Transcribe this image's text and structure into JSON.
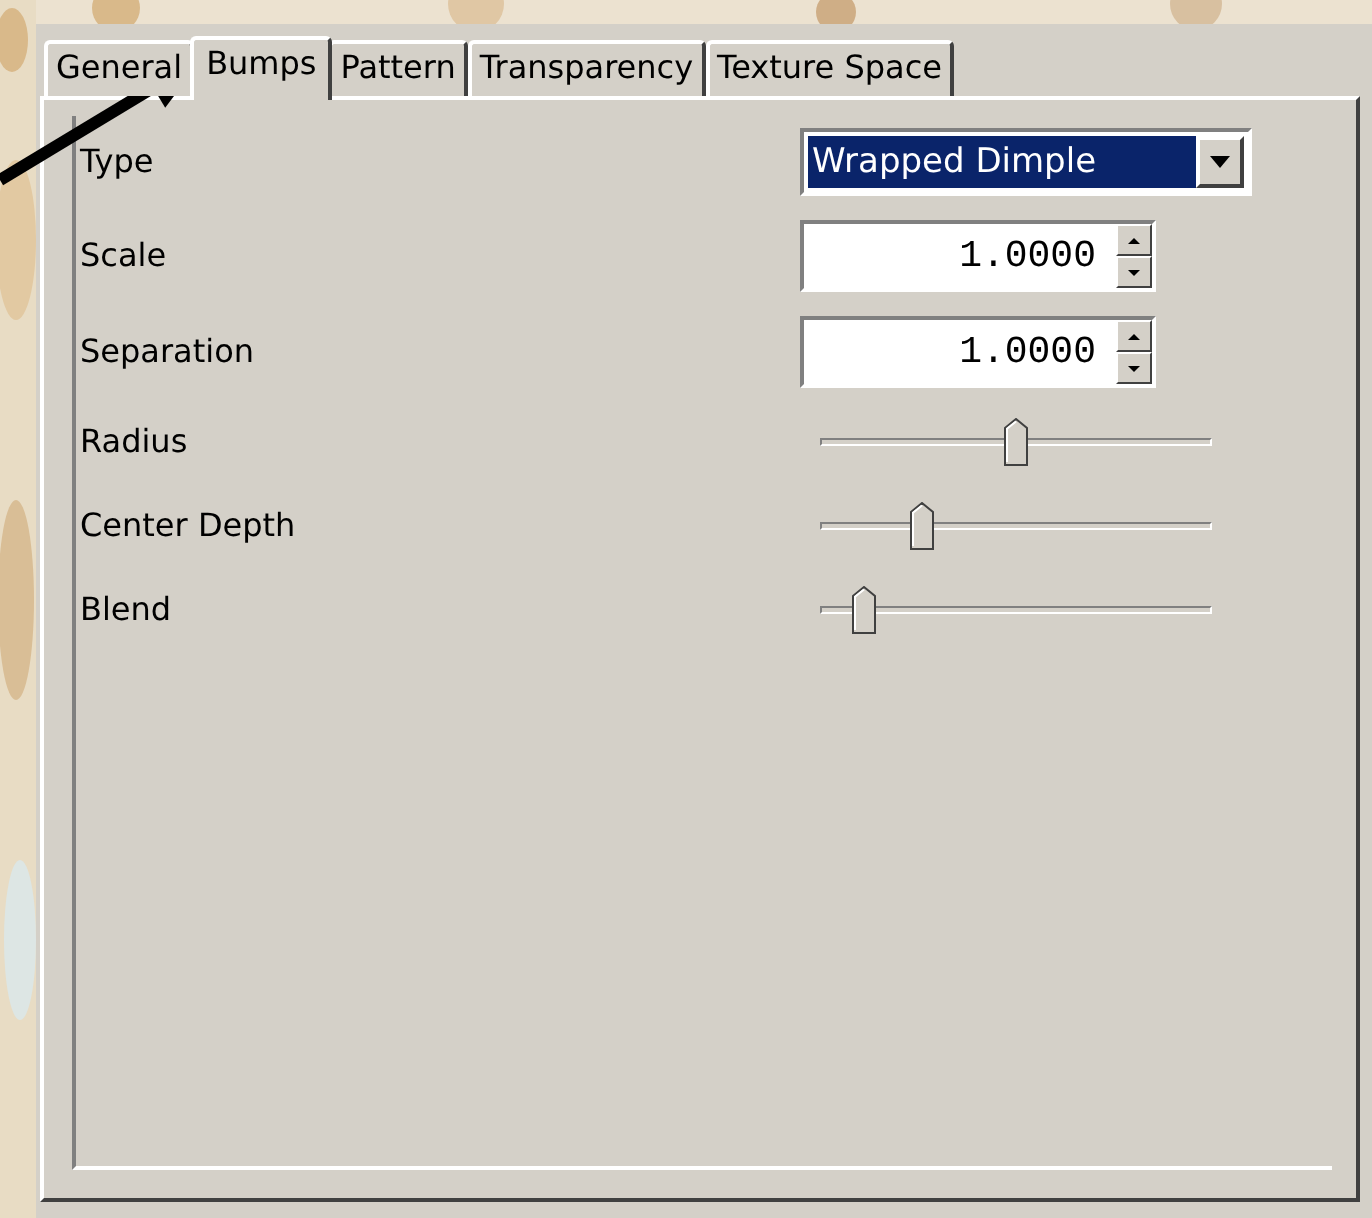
{
  "tabs": [
    {
      "label": "General",
      "selected": false
    },
    {
      "label": "Bumps",
      "selected": true
    },
    {
      "label": "Pattern",
      "selected": false
    },
    {
      "label": "Transparency",
      "selected": false
    },
    {
      "label": "Texture Space",
      "selected": false
    }
  ],
  "fields": [
    {
      "kind": "dropdown",
      "label": "Type",
      "value": "Wrapped Dimple"
    },
    {
      "kind": "spinner",
      "label": "Scale",
      "value": "1.0000"
    },
    {
      "kind": "spinner",
      "label": "Separation",
      "value": "1.0000"
    },
    {
      "kind": "slider",
      "label": "Radius",
      "level": 0.5
    },
    {
      "kind": "slider",
      "label": "Center Depth",
      "level": 0.26
    },
    {
      "kind": "slider",
      "label": "Blend",
      "level": 0.11
    }
  ]
}
